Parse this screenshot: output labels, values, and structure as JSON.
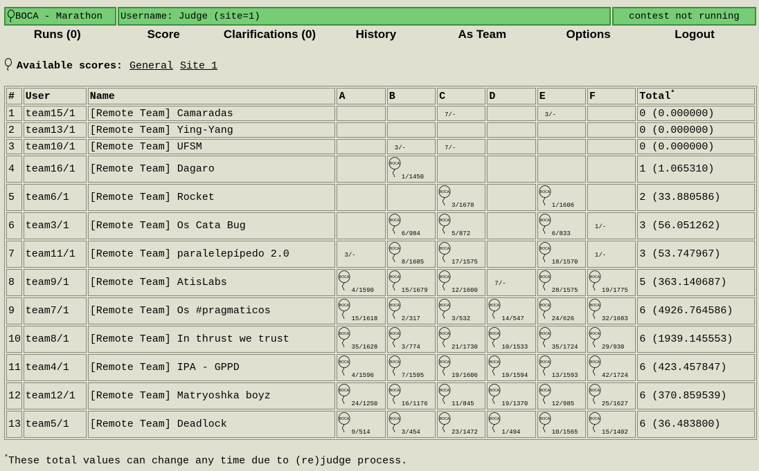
{
  "header": {
    "title": "BOCA - Marathon",
    "user": "Username: Judge (site=1)",
    "status": "contest not running"
  },
  "menu": [
    {
      "label": "Runs (0)"
    },
    {
      "label": "Score"
    },
    {
      "label": "Clarifications (0)"
    },
    {
      "label": "History"
    },
    {
      "label": "As Team"
    },
    {
      "label": "Options"
    },
    {
      "label": "Logout"
    }
  ],
  "scores": {
    "label": "Available scores:",
    "links": [
      "General",
      "Site_1"
    ]
  },
  "balloon_text": "BOCA",
  "table": {
    "headers": [
      "#",
      "User",
      "Name",
      "A",
      "B",
      "C",
      "D",
      "E",
      "F",
      "Total"
    ],
    "total_mark": "*",
    "rows": [
      {
        "rank": "1",
        "user": "team15/1",
        "name": "[Remote Team] Camaradas",
        "total": "0 (0.000000)",
        "problems": [
          null,
          null,
          {
            "t": "7/-"
          },
          null,
          {
            "t": "3/-"
          },
          null
        ]
      },
      {
        "rank": "2",
        "user": "team13/1",
        "name": "[Remote Team] Ying-Yang",
        "total": "0 (0.000000)",
        "problems": [
          null,
          null,
          null,
          null,
          null,
          null
        ]
      },
      {
        "rank": "3",
        "user": "team10/1",
        "name": "[Remote Team] UFSM",
        "total": "0 (0.000000)",
        "problems": [
          null,
          {
            "t": "3/-"
          },
          {
            "t": "7/-"
          },
          null,
          null,
          null
        ]
      },
      {
        "rank": "4",
        "user": "team16/1",
        "name": "[Remote Team] Dagaro",
        "total": "1 (1.065310)",
        "problems": [
          null,
          {
            "t": "1/1450",
            "b": true
          },
          null,
          null,
          null,
          null
        ]
      },
      {
        "rank": "5",
        "user": "team6/1",
        "name": "[Remote Team] Rocket",
        "total": "2 (33.880586)",
        "problems": [
          null,
          null,
          {
            "t": "3/1678",
            "b": true
          },
          null,
          {
            "t": "1/1606",
            "b": true
          },
          null
        ]
      },
      {
        "rank": "6",
        "user": "team3/1",
        "name": "[Remote Team] Os Cata Bug",
        "total": "3 (56.051262)",
        "problems": [
          null,
          {
            "t": "6/984",
            "b": true
          },
          {
            "t": "5/872",
            "b": true
          },
          null,
          {
            "t": "6/833",
            "b": true
          },
          {
            "t": "1/-"
          }
        ]
      },
      {
        "rank": "7",
        "user": "team11/1",
        "name": "[Remote Team] paralelepípedo 2.0",
        "total": "3 (53.747967)",
        "problems": [
          {
            "t": "3/-"
          },
          {
            "t": "8/1685",
            "b": true
          },
          {
            "t": "17/1575",
            "b": true
          },
          null,
          {
            "t": "18/1570",
            "b": true
          },
          {
            "t": "1/-"
          }
        ]
      },
      {
        "rank": "8",
        "user": "team9/1",
        "name": "[Remote Team] AtisLabs",
        "total": "5 (363.140687)",
        "problems": [
          {
            "t": "4/1590",
            "b": true
          },
          {
            "t": "15/1679",
            "b": true
          },
          {
            "t": "12/1600",
            "b": true
          },
          {
            "t": "7/-"
          },
          {
            "t": "28/1575",
            "b": true
          },
          {
            "t": "19/1775",
            "b": true
          }
        ]
      },
      {
        "rank": "9",
        "user": "team7/1",
        "name": "[Remote Team] Os #pragmaticos",
        "total": "6 (4926.764586)",
        "problems": [
          {
            "t": "15/1618",
            "b": true
          },
          {
            "t": "2/317",
            "b": true
          },
          {
            "t": "3/532",
            "b": true
          },
          {
            "t": "14/547",
            "b": true
          },
          {
            "t": "24/626",
            "b": true
          },
          {
            "t": "32/1683",
            "b": true
          }
        ]
      },
      {
        "rank": "10",
        "user": "team8/1",
        "name": "[Remote Team] In thrust we trust",
        "total": "6 (1939.145553)",
        "problems": [
          {
            "t": "35/1628",
            "b": true
          },
          {
            "t": "3/774",
            "b": true
          },
          {
            "t": "21/1730",
            "b": true
          },
          {
            "t": "10/1533",
            "b": true
          },
          {
            "t": "35/1724",
            "b": true
          },
          {
            "t": "29/930",
            "b": true
          }
        ]
      },
      {
        "rank": "11",
        "user": "team4/1",
        "name": "[Remote Team] IPA - GPPD",
        "total": "6 (423.457847)",
        "problems": [
          {
            "t": "4/1596",
            "b": true
          },
          {
            "t": "7/1595",
            "b": true
          },
          {
            "t": "19/1606",
            "b": true
          },
          {
            "t": "19/1594",
            "b": true
          },
          {
            "t": "13/1593",
            "b": true
          },
          {
            "t": "42/1724",
            "b": true
          }
        ]
      },
      {
        "rank": "12",
        "user": "team12/1",
        "name": "[Remote Team] Matryoshka boyz",
        "total": "6 (370.859539)",
        "problems": [
          {
            "t": "24/1250",
            "b": true
          },
          {
            "t": "16/1176",
            "b": true
          },
          {
            "t": "11/845",
            "b": true
          },
          {
            "t": "19/1370",
            "b": true
          },
          {
            "t": "12/985",
            "b": true
          },
          {
            "t": "25/1627",
            "b": true
          }
        ]
      },
      {
        "rank": "13",
        "user": "team5/1",
        "name": "[Remote Team] Deadlock",
        "total": "6 (36.483800)",
        "problems": [
          {
            "t": "9/514",
            "b": true
          },
          {
            "t": "3/454",
            "b": true
          },
          {
            "t": "23/1472",
            "b": true
          },
          {
            "t": "1/494",
            "b": true
          },
          {
            "t": "10/1565",
            "b": true
          },
          {
            "t": "15/1402",
            "b": true
          }
        ]
      }
    ]
  },
  "footer": {
    "mark": "*",
    "text": "These total values can change any time due to (re)judge process."
  }
}
